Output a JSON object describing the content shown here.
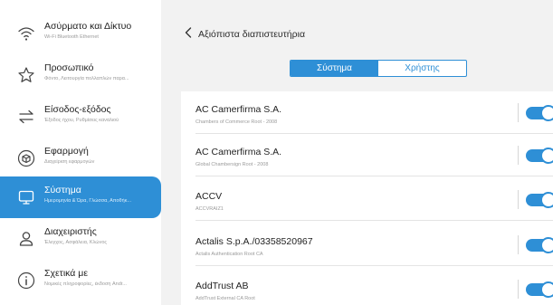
{
  "sidebar": {
    "items": [
      {
        "title": "Ασύρματο και Δίκτυο",
        "subtitle": "Wi-Fi Bluetooth Ethernet",
        "icon": "wifi-icon"
      },
      {
        "title": "Προσωπικό",
        "subtitle": "Φόντο, Λειτουργία πολλαπλών παρα...",
        "icon": "star-icon"
      },
      {
        "title": "Είσοδος-εξόδος",
        "subtitle": "Έξοδος ήχου, Ρυθμίσεις καναλιού",
        "icon": "input-output-icon"
      },
      {
        "title": "Εφαρμογή",
        "subtitle": "Διαχείριση εφαρμογών",
        "icon": "app-cube-icon"
      },
      {
        "title": "Σύστημα",
        "subtitle": "Ημερομηνία & Ώρα, Γλώσσα, Αποθήκ...",
        "icon": "monitor-icon",
        "active": true
      },
      {
        "title": "Διαχειριστής",
        "subtitle": "Έλεγχος, Ασφάλεια, Κλώνος",
        "icon": "user-icon"
      },
      {
        "title": "Σχετικά με",
        "subtitle": "Νομικές πληροφορίες, έκδοση Andr...",
        "icon": "info-icon"
      }
    ]
  },
  "header": {
    "title": "Αξιόπιστα διαπιστευτήρια",
    "back_icon": "chevron-left-icon"
  },
  "segments": {
    "system_label": "Σύστημα",
    "user_label": "Χρήστης",
    "selected": "system"
  },
  "certificates": [
    {
      "title": "AC Camerfirma S.A.",
      "subtitle": "Chambers of Commerce Root - 2008",
      "enabled": true
    },
    {
      "title": "AC Camerfirma S.A.",
      "subtitle": "Global Chambersign Root - 2008",
      "enabled": true
    },
    {
      "title": "ACCV",
      "subtitle": "ACCVRAIZ1",
      "enabled": true
    },
    {
      "title": "Actalis S.p.A./03358520967",
      "subtitle": "Actalis Authentication Root CA",
      "enabled": true
    },
    {
      "title": "AddTrust AB",
      "subtitle": "AddTrust External CA Root",
      "enabled": true
    }
  ],
  "colors": {
    "accent": "#2e8fd6",
    "sidebar_bg": "#ffffff",
    "main_bg": "#f2f2f2"
  }
}
